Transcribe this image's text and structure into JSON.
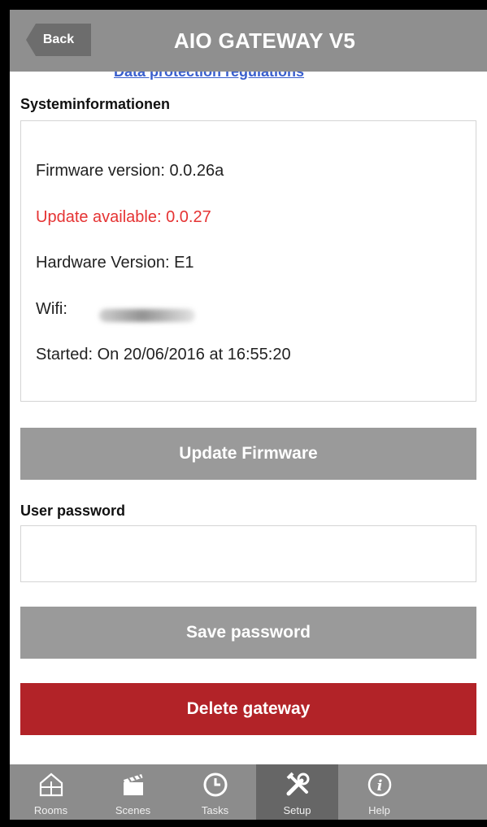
{
  "header": {
    "back_label": "Back",
    "title": "AIO GATEWAY V5"
  },
  "content": {
    "cut_link_text": "Data protection regulations",
    "system_info": {
      "heading": "Systeminformationen",
      "firmware": "Firmware version: 0.0.26a",
      "update": "Update available: 0.0.27",
      "hardware": "Hardware Version: E1",
      "wifi_label": "Wifi:",
      "started": "Started: On 20/06/2016 at 16:55:20"
    },
    "update_button": "Update Firmware",
    "password": {
      "label": "User password",
      "value": "",
      "placeholder": ""
    },
    "save_button": "Save password",
    "delete_button": "Delete gateway"
  },
  "tabs": [
    {
      "label": "Rooms",
      "icon": "house-grid-icon"
    },
    {
      "label": "Scenes",
      "icon": "clapperboard-icon"
    },
    {
      "label": "Tasks",
      "icon": "clock-icon"
    },
    {
      "label": "Setup",
      "icon": "tools-icon",
      "active": true
    },
    {
      "label": "Help",
      "icon": "info-icon"
    }
  ],
  "colors": {
    "header_bg": "#8f8f8f",
    "button_gray": "#9a9a9a",
    "danger_red": "#b22328",
    "update_text_red": "#e53333",
    "link_blue": "#3a5fcd"
  }
}
